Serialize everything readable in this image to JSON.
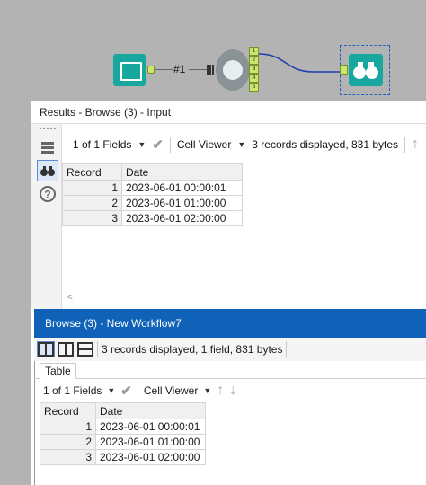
{
  "canvas": {
    "connection_label": "#1",
    "python_anchors": [
      "1",
      "2",
      "3",
      "4",
      "5"
    ],
    "colors": {
      "canvas_bg": "#b3b3b3",
      "tool_teal": "#17a79e",
      "anchor_green": "#c9e86a",
      "wire_blue": "#1e3fb0"
    }
  },
  "results": {
    "title": "Results - Browse (3) - Input",
    "fields_selector": "1 of 1 Fields",
    "viewer": "Cell Viewer",
    "summary": "3 records displayed, 831 bytes",
    "columns": [
      "Record",
      "Date"
    ],
    "rows": [
      {
        "record": "1",
        "date": "2023-06-01 00:00:01"
      },
      {
        "record": "2",
        "date": "2023-06-01 01:00:00"
      },
      {
        "record": "3",
        "date": "2023-06-01 02:00:00"
      }
    ],
    "scroll_left": "<"
  },
  "browse": {
    "title": "Browse (3) - New Workflow7",
    "summary": "3 records displayed, 1 field, 831 bytes",
    "tab": "Table",
    "fields_selector": "1 of 1 Fields",
    "viewer": "Cell Viewer",
    "columns": [
      "Record",
      "Date"
    ],
    "rows": [
      {
        "record": "1",
        "date": "2023-06-01 00:00:01"
      },
      {
        "record": "2",
        "date": "2023-06-01 01:00:00"
      },
      {
        "record": "3",
        "date": "2023-06-01 02:00:00"
      }
    ],
    "title_bar_color": "#0f62b8"
  },
  "icons": {
    "input": "book-icon",
    "python": "python-icon",
    "browse": "binoculars-icon",
    "list": "list-view-icon",
    "help": "help-icon",
    "check": "check-icon",
    "up": "arrow-up-icon",
    "down": "arrow-down-icon"
  }
}
